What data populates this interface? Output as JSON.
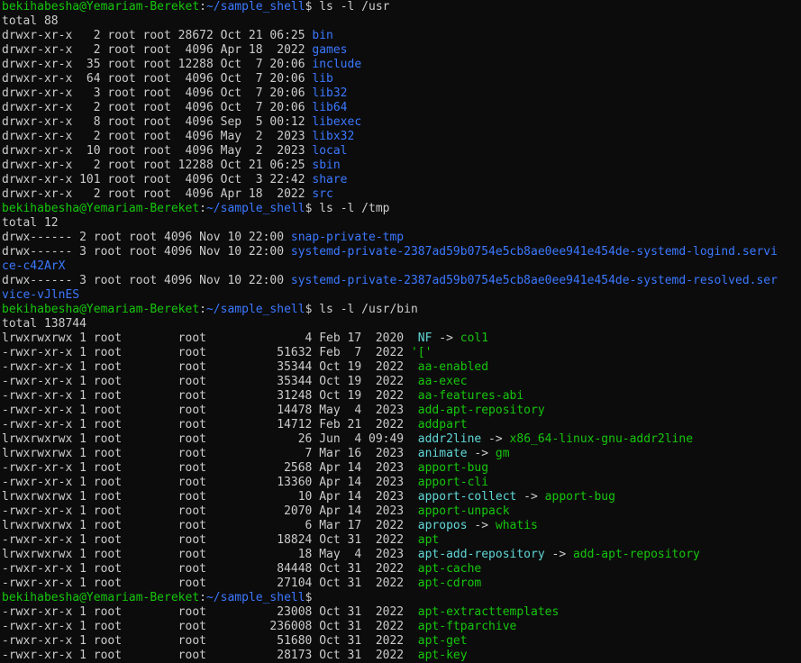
{
  "colors": {
    "background": "#0c0c0c",
    "foreground": "#cccccc",
    "prompt_user": "#16c60c",
    "prompt_path": "#3b78ff",
    "directory": "#3b78ff",
    "executable": "#16c60c",
    "symlink": "#61d6d6"
  },
  "prompt": {
    "user_host": "bekihabesha@Yemariam-Bereket",
    "path": "~/sample_shell"
  },
  "lines": [
    {
      "type": "prompt",
      "cmd": "ls -l /usr"
    },
    {
      "type": "text",
      "text": "total 88"
    },
    {
      "type": "entry",
      "meta": "drwxr-xr-x   2 root root 28672 Oct 21 06:25 ",
      "name": "bin",
      "cls": "dir"
    },
    {
      "type": "entry",
      "meta": "drwxr-xr-x   2 root root  4096 Apr 18  2022 ",
      "name": "games",
      "cls": "dir"
    },
    {
      "type": "entry",
      "meta": "drwxr-xr-x  35 root root 12288 Oct  7 20:06 ",
      "name": "include",
      "cls": "dir"
    },
    {
      "type": "entry",
      "meta": "drwxr-xr-x  64 root root  4096 Oct  7 20:06 ",
      "name": "lib",
      "cls": "dir"
    },
    {
      "type": "entry",
      "meta": "drwxr-xr-x   3 root root  4096 Oct  7 20:06 ",
      "name": "lib32",
      "cls": "dir"
    },
    {
      "type": "entry",
      "meta": "drwxr-xr-x   2 root root  4096 Oct  7 20:06 ",
      "name": "lib64",
      "cls": "dir"
    },
    {
      "type": "entry",
      "meta": "drwxr-xr-x   8 root root  4096 Sep  5 00:12 ",
      "name": "libexec",
      "cls": "dir"
    },
    {
      "type": "entry",
      "meta": "drwxr-xr-x   2 root root  4096 May  2  2023 ",
      "name": "libx32",
      "cls": "dir"
    },
    {
      "type": "entry",
      "meta": "drwxr-xr-x  10 root root  4096 May  2  2023 ",
      "name": "local",
      "cls": "dir"
    },
    {
      "type": "entry",
      "meta": "drwxr-xr-x   2 root root 12288 Oct 21 06:25 ",
      "name": "sbin",
      "cls": "dir"
    },
    {
      "type": "entry",
      "meta": "drwxr-xr-x 101 root root  4096 Oct  3 22:42 ",
      "name": "share",
      "cls": "dir"
    },
    {
      "type": "entry",
      "meta": "drwxr-xr-x   2 root root  4096 Apr 18  2022 ",
      "name": "src",
      "cls": "dir"
    },
    {
      "type": "prompt",
      "cmd": "ls -l /tmp"
    },
    {
      "type": "text",
      "text": "total 12"
    },
    {
      "type": "entry",
      "meta": "drwx------ 2 root root 4096 Nov 10 22:00 ",
      "name": "snap-private-tmp",
      "cls": "dir"
    },
    {
      "type": "entry",
      "meta": "drwx------ 3 root root 4096 Nov 10 22:00 ",
      "name": "systemd-private-2387ad59b0754e5cb8ae0ee941e454de-systemd-logind.servi",
      "cls": "dir"
    },
    {
      "type": "entry",
      "meta": "",
      "name": "ce-c42ArX",
      "cls": "dir"
    },
    {
      "type": "entry",
      "meta": "drwx------ 3 root root 4096 Nov 10 22:00 ",
      "name": "systemd-private-2387ad59b0754e5cb8ae0ee941e454de-systemd-resolved.ser",
      "cls": "dir"
    },
    {
      "type": "entry",
      "meta": "",
      "name": "vice-vJlnES",
      "cls": "dir"
    },
    {
      "type": "prompt",
      "cmd": "ls -l /usr/bin"
    },
    {
      "type": "text",
      "text": "total 138744"
    },
    {
      "type": "entry",
      "meta": "lrwxrwxrwx 1 root        root              4 Feb 17  2020  ",
      "name": "NF",
      "cls": "link",
      "arrow": " -> ",
      "target": "col1",
      "tcls": "exec"
    },
    {
      "type": "entry",
      "meta": "-rwxr-xr-x 1 root        root          51632 Feb  7  2022 ",
      "name": "'['",
      "cls": "exec"
    },
    {
      "type": "entry",
      "meta": "-rwxr-xr-x 1 root        root          35344 Oct 19  2022  ",
      "name": "aa-enabled",
      "cls": "exec"
    },
    {
      "type": "entry",
      "meta": "-rwxr-xr-x 1 root        root          35344 Oct 19  2022  ",
      "name": "aa-exec",
      "cls": "exec"
    },
    {
      "type": "entry",
      "meta": "-rwxr-xr-x 1 root        root          31248 Oct 19  2022  ",
      "name": "aa-features-abi",
      "cls": "exec"
    },
    {
      "type": "entry",
      "meta": "-rwxr-xr-x 1 root        root          14478 May  4  2023  ",
      "name": "add-apt-repository",
      "cls": "exec"
    },
    {
      "type": "entry",
      "meta": "-rwxr-xr-x 1 root        root          14712 Feb 21  2022  ",
      "name": "addpart",
      "cls": "exec"
    },
    {
      "type": "entry",
      "meta": "lrwxrwxrwx 1 root        root             26 Jun  4 09:49  ",
      "name": "addr2line",
      "cls": "link",
      "arrow": " -> ",
      "target": "x86_64-linux-gnu-addr2line",
      "tcls": "exec"
    },
    {
      "type": "entry",
      "meta": "lrwxrwxrwx 1 root        root              7 Mar 16  2023  ",
      "name": "animate",
      "cls": "link",
      "arrow": " -> ",
      "target": "gm",
      "tcls": "exec"
    },
    {
      "type": "entry",
      "meta": "-rwxr-xr-x 1 root        root           2568 Apr 14  2023  ",
      "name": "apport-bug",
      "cls": "exec"
    },
    {
      "type": "entry",
      "meta": "-rwxr-xr-x 1 root        root          13360 Apr 14  2023  ",
      "name": "apport-cli",
      "cls": "exec"
    },
    {
      "type": "entry",
      "meta": "lrwxrwxrwx 1 root        root             10 Apr 14  2023  ",
      "name": "apport-collect",
      "cls": "link",
      "arrow": " -> ",
      "target": "apport-bug",
      "tcls": "exec"
    },
    {
      "type": "entry",
      "meta": "-rwxr-xr-x 1 root        root           2070 Apr 14  2023  ",
      "name": "apport-unpack",
      "cls": "exec"
    },
    {
      "type": "entry",
      "meta": "lrwxrwxrwx 1 root        root              6 Mar 17  2022  ",
      "name": "apropos",
      "cls": "link",
      "arrow": " -> ",
      "target": "whatis",
      "tcls": "exec"
    },
    {
      "type": "entry",
      "meta": "-rwxr-xr-x 1 root        root          18824 Oct 31  2022  ",
      "name": "apt",
      "cls": "exec"
    },
    {
      "type": "entry",
      "meta": "lrwxrwxrwx 1 root        root             18 May  4  2023  ",
      "name": "apt-add-repository",
      "cls": "link",
      "arrow": " -> ",
      "target": "add-apt-repository",
      "tcls": "exec"
    },
    {
      "type": "entry",
      "meta": "-rwxr-xr-x 1 root        root          84448 Oct 31  2022  ",
      "name": "apt-cache",
      "cls": "exec"
    },
    {
      "type": "entry",
      "meta": "-rwxr-xr-x 1 root        root          27104 Oct 31  2022  ",
      "name": "apt-cdrom",
      "cls": "exec"
    },
    {
      "type": "prompt",
      "cmd": ""
    },
    {
      "type": "entry",
      "meta": "-rwxr-xr-x 1 root        root          23008 Oct 31  2022  ",
      "name": "apt-extracttemplates",
      "cls": "exec"
    },
    {
      "type": "entry",
      "meta": "-rwxr-xr-x 1 root        root         236008 Oct 31  2022  ",
      "name": "apt-ftparchive",
      "cls": "exec"
    },
    {
      "type": "entry",
      "meta": "-rwxr-xr-x 1 root        root          51680 Oct 31  2022  ",
      "name": "apt-get",
      "cls": "exec"
    },
    {
      "type": "entry",
      "meta": "-rwxr-xr-x 1 root        root          28173 Oct 31  2022  ",
      "name": "apt-key",
      "cls": "exec"
    }
  ]
}
